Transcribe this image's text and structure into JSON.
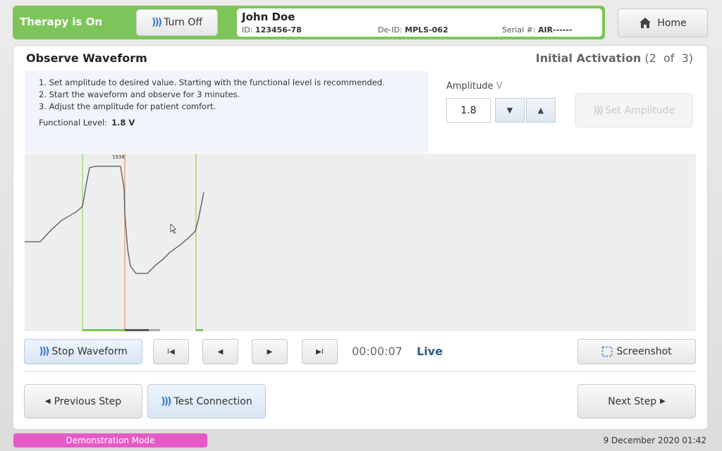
{
  "header": {
    "therapy_status": "Therapy is On",
    "turn_off_label": "Turn Off",
    "home_label": "Home"
  },
  "patient": {
    "name": "John Doe",
    "id_label": "ID:",
    "id_value": "123456-78",
    "deid_label": "De-ID:",
    "deid_value": "MPLS-062",
    "serial_label": "Serial #:",
    "serial_value": "AIR------"
  },
  "panel": {
    "title": "Observe Waveform",
    "step_name": "Initial Activation",
    "step_progress": "(2  of  3)"
  },
  "instructions": {
    "steps": [
      "1. Set amplitude to desired value. Starting with the functional level is recommended.",
      "2. Start the waveform and observe for 3 minutes.",
      "3. Adjust the amplitude for patient comfort."
    ],
    "functional_label": "Functional Level:",
    "functional_value": "1.8 V"
  },
  "amplitude": {
    "label": "Amplitude",
    "unit": "V",
    "value": "1.8",
    "decrease_glyph": "▼",
    "increase_glyph": "▲",
    "set_label": "Set Amplitude"
  },
  "waveform": {
    "marker_label": "1938"
  },
  "controls": {
    "stop_label": "Stop Waveform",
    "first_glyph": "I◀",
    "prev_glyph": "◀",
    "next_glyph": "▶",
    "last_glyph": "▶I",
    "timer": "00:00:07",
    "live": "Live",
    "screenshot_label": "Screenshot"
  },
  "nav": {
    "previous_label": "Previous Step",
    "test_label": "Test Connection",
    "next_label": "Next Step"
  },
  "footer": {
    "mode": "Demonstration Mode",
    "datetime": "9 December 2020 01:42"
  },
  "colors": {
    "therapy_green": "#7dc55a",
    "accent_blue": "#3a7fd0",
    "live_blue": "#2b5c86",
    "demo_pink": "#e65ac8"
  }
}
